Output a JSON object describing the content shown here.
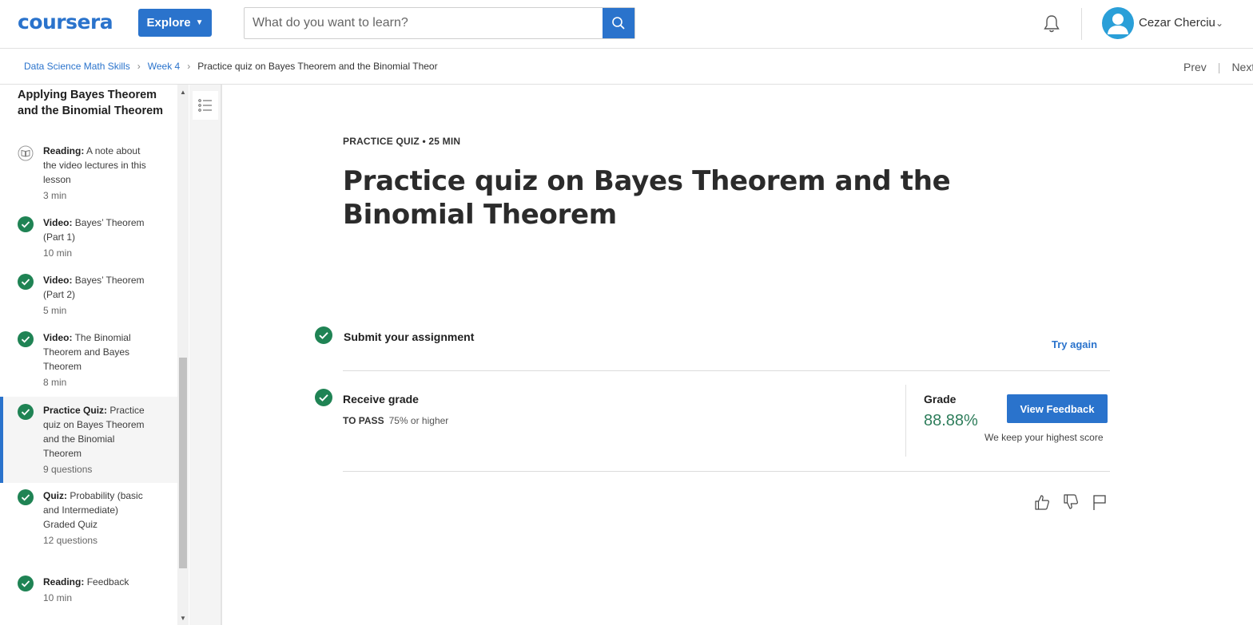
{
  "header": {
    "logo_text": "coursera",
    "explore_label": "Explore",
    "search_placeholder": "What do you want to learn?",
    "user_name": "Cezar Cherciu"
  },
  "breadcrumb": {
    "items": [
      "Data Science Math Skills",
      "Week 4"
    ],
    "current": "Practice quiz on Bayes Theorem and the Binomial Theor",
    "prev": "Prev",
    "next": "Next"
  },
  "sidebar": {
    "section_title": "Applying Bayes Theorem and the Binomial Theorem",
    "items": [
      {
        "type": "Reading:",
        "title": "A note about the video lectures in this lesson",
        "meta": "3 min",
        "icon": "book-icon"
      },
      {
        "type": "Video:",
        "title": "Bayes’ Theorem (Part 1)",
        "meta": "10 min",
        "icon": "check-circle-icon"
      },
      {
        "type": "Video:",
        "title": "Bayes’ Theorem (Part 2)",
        "meta": "5 min",
        "icon": "check-circle-icon"
      },
      {
        "type": "Video:",
        "title": "The Binomial Theorem and Bayes Theorem",
        "meta": "8 min",
        "icon": "check-circle-icon"
      },
      {
        "type": "Practice Quiz:",
        "title": "Practice quiz on Bayes Theorem and the Binomial Theorem",
        "meta": "9 questions",
        "icon": "check-circle-icon"
      },
      {
        "type": "Quiz:",
        "title": "Probability (basic and Intermediate) Graded Quiz",
        "meta": "12 questions",
        "icon": "check-circle-icon"
      },
      {
        "type": "Reading:",
        "title": "Feedback",
        "meta": "10 min",
        "icon": "check-circle-icon"
      }
    ]
  },
  "main": {
    "kicker": "PRACTICE QUIZ • 25 MIN",
    "title": "Practice quiz on Bayes Theorem and the Binomial Theorem",
    "submit_label": "Submit your assignment",
    "try_again": "Try again",
    "receive_label": "Receive grade",
    "to_pass_label": "TO PASS",
    "to_pass_value": "75% or higher",
    "grade_label": "Grade",
    "grade_value": "88.88%",
    "view_feedback": "View Feedback",
    "keep_score": "We keep your highest score"
  },
  "colors": {
    "brand_blue": "#2a73cc",
    "success_green": "#1f8354",
    "grade_green": "#2e7d5b"
  }
}
